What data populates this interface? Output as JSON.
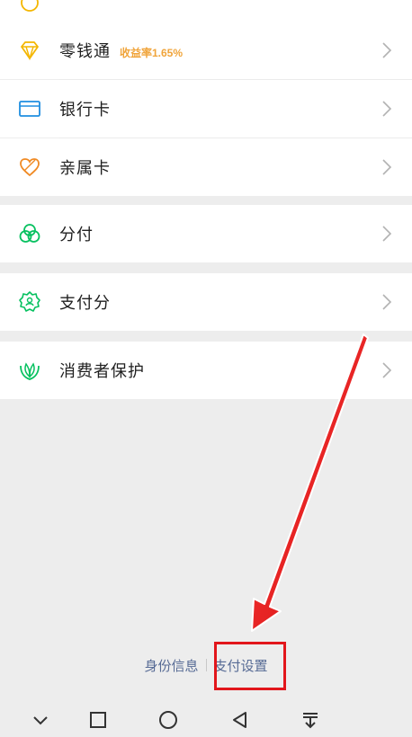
{
  "menu": {
    "items": [
      {
        "label": "零钱通",
        "badge": "收益率1.65%",
        "icon": "diamond-icon"
      },
      {
        "label": "银行卡",
        "icon": "bank-card-icon"
      },
      {
        "label": "亲属卡",
        "icon": "family-card-icon"
      },
      {
        "label": "分付",
        "icon": "split-pay-icon"
      },
      {
        "label": "支付分",
        "icon": "pay-score-icon"
      },
      {
        "label": "消费者保护",
        "icon": "consumer-protection-icon"
      }
    ]
  },
  "footer": {
    "identity_link": "身份信息",
    "pay_settings_link": "支付设置"
  },
  "colors": {
    "accent_green": "#07c160",
    "link_blue": "#576b95",
    "badge_orange": "#f0a43a",
    "annotation_red": "#e2161b"
  }
}
